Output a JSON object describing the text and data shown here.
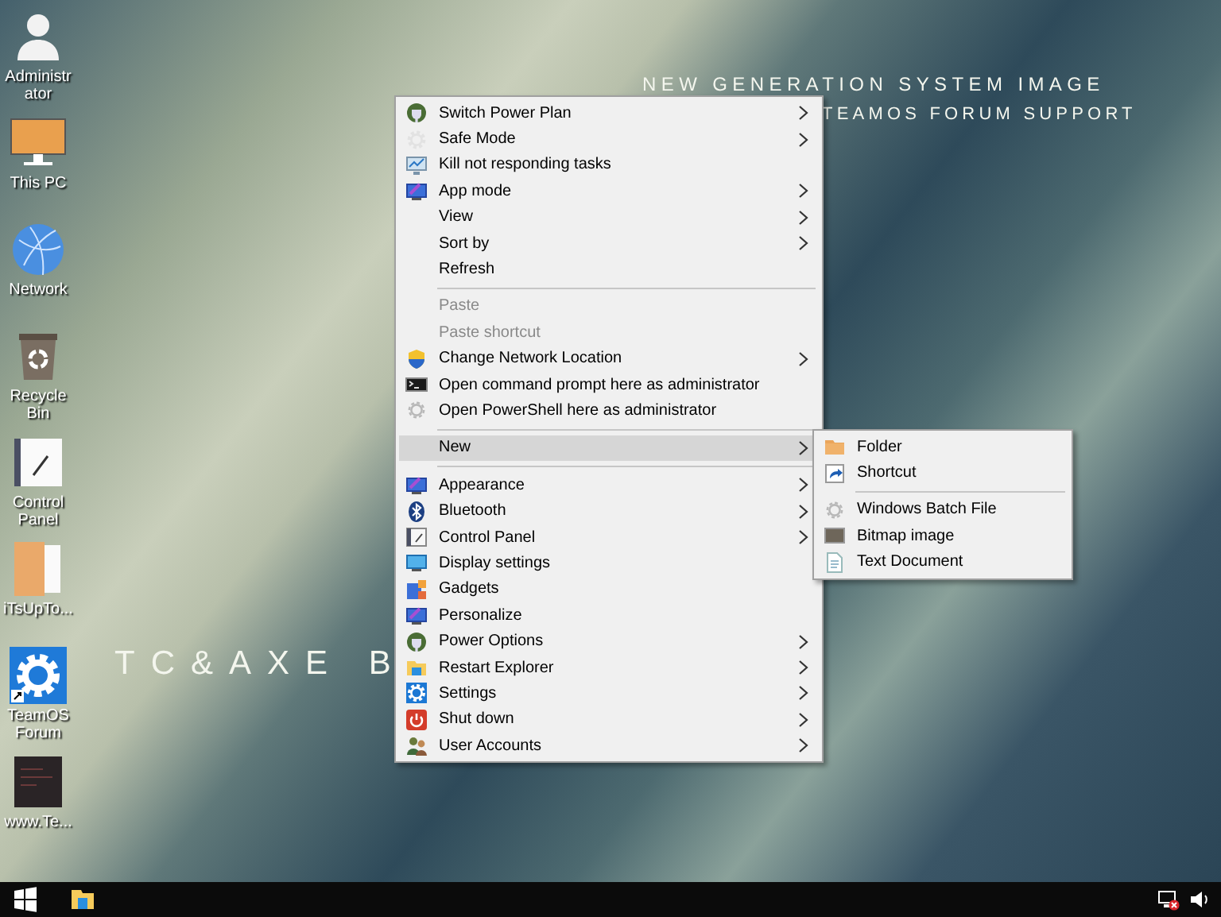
{
  "desktop": {
    "wallpaper_texts": [
      {
        "kind": "headline",
        "text": "NEW GENERATION SYSTEM IMAGE"
      },
      {
        "kind": "subline",
        "text": "TEAMOS FORUM SUPPORT"
      },
      {
        "kind": "logo",
        "text": "TC&AXE B"
      }
    ],
    "icons": [
      {
        "kind": "user",
        "label": "Administrator"
      },
      {
        "kind": "monitor",
        "label": "This PC"
      },
      {
        "kind": "globe",
        "label": "Network"
      },
      {
        "kind": "recycle",
        "label": "Recycle Bin"
      },
      {
        "kind": "panel",
        "label": "Control Panel"
      },
      {
        "kind": "folder",
        "label": "iTsUpTo..."
      },
      {
        "kind": "gear-shortcut",
        "label": "TeamOS Forum"
      },
      {
        "kind": "dark-app",
        "label": "www.Te..."
      }
    ]
  },
  "context_menu": {
    "groups": [
      {
        "items": [
          {
            "kind": "plug",
            "label": "Switch Power Plan",
            "submenu": true,
            "disabled": false,
            "selected": false
          },
          {
            "kind": "gear-light",
            "label": "Safe Mode",
            "submenu": true,
            "disabled": false,
            "selected": false
          },
          {
            "kind": "monitor-chart",
            "label": "Kill not responding tasks",
            "submenu": false,
            "disabled": false,
            "selected": false
          },
          {
            "kind": "monitor-check",
            "label": "App mode",
            "submenu": true,
            "disabled": false,
            "selected": false
          },
          {
            "kind": "none",
            "label": "View",
            "submenu": true,
            "disabled": false,
            "selected": false
          },
          {
            "kind": "none",
            "label": "Sort by",
            "submenu": true,
            "disabled": false,
            "selected": false
          },
          {
            "kind": "none",
            "label": "Refresh",
            "submenu": false,
            "disabled": false,
            "selected": false
          }
        ]
      },
      {
        "items": [
          {
            "kind": "none",
            "label": "Paste",
            "submenu": false,
            "disabled": true,
            "selected": false
          },
          {
            "kind": "none",
            "label": "Paste shortcut",
            "submenu": false,
            "disabled": true,
            "selected": false
          },
          {
            "kind": "shield",
            "label": "Change Network Location",
            "submenu": true,
            "disabled": false,
            "selected": false
          },
          {
            "kind": "console",
            "label": "Open command prompt here as administrator",
            "submenu": false,
            "disabled": false,
            "selected": false
          },
          {
            "kind": "gear-outline",
            "label": "Open PowerShell here as administrator",
            "submenu": false,
            "disabled": false,
            "selected": false
          }
        ]
      },
      {
        "items": [
          {
            "kind": "none",
            "label": "New",
            "submenu": true,
            "disabled": false,
            "selected": true
          }
        ]
      },
      {
        "items": [
          {
            "kind": "monitor-check",
            "label": "Appearance",
            "submenu": true,
            "disabled": false,
            "selected": false
          },
          {
            "kind": "bluetooth",
            "label": "Bluetooth",
            "submenu": true,
            "disabled": false,
            "selected": false
          },
          {
            "kind": "panel",
            "label": "Control Panel",
            "submenu": true,
            "disabled": false,
            "selected": false
          },
          {
            "kind": "display",
            "label": "Display settings",
            "submenu": false,
            "disabled": false,
            "selected": false
          },
          {
            "kind": "gadgets",
            "label": "Gadgets",
            "submenu": false,
            "disabled": false,
            "selected": false
          },
          {
            "kind": "monitor-check",
            "label": "Personalize",
            "submenu": false,
            "disabled": false,
            "selected": false
          },
          {
            "kind": "plug",
            "label": "Power Options",
            "submenu": true,
            "disabled": false,
            "selected": false
          },
          {
            "kind": "folder-blue",
            "label": "Restart Explorer",
            "submenu": true,
            "disabled": false,
            "selected": false
          },
          {
            "kind": "settings",
            "label": "Settings",
            "submenu": true,
            "disabled": false,
            "selected": false
          },
          {
            "kind": "power",
            "label": "Shut down",
            "submenu": true,
            "disabled": false,
            "selected": false
          },
          {
            "kind": "users",
            "label": "User Accounts",
            "submenu": true,
            "disabled": false,
            "selected": false
          }
        ]
      }
    ]
  },
  "submenu": {
    "groups": [
      {
        "items": [
          {
            "kind": "folder",
            "label": "Folder"
          },
          {
            "kind": "shortcut",
            "label": "Shortcut"
          }
        ]
      },
      {
        "items": [
          {
            "kind": "gear-outline",
            "label": "Windows Batch File"
          },
          {
            "kind": "bitmap",
            "label": "Bitmap image"
          },
          {
            "kind": "text-doc",
            "label": "Text Document"
          }
        ]
      }
    ]
  },
  "taskbar": {
    "items": [
      {
        "kind": "start"
      },
      {
        "kind": "explorer"
      }
    ],
    "tray": [
      {
        "kind": "network-error"
      },
      {
        "kind": "speaker"
      }
    ]
  }
}
